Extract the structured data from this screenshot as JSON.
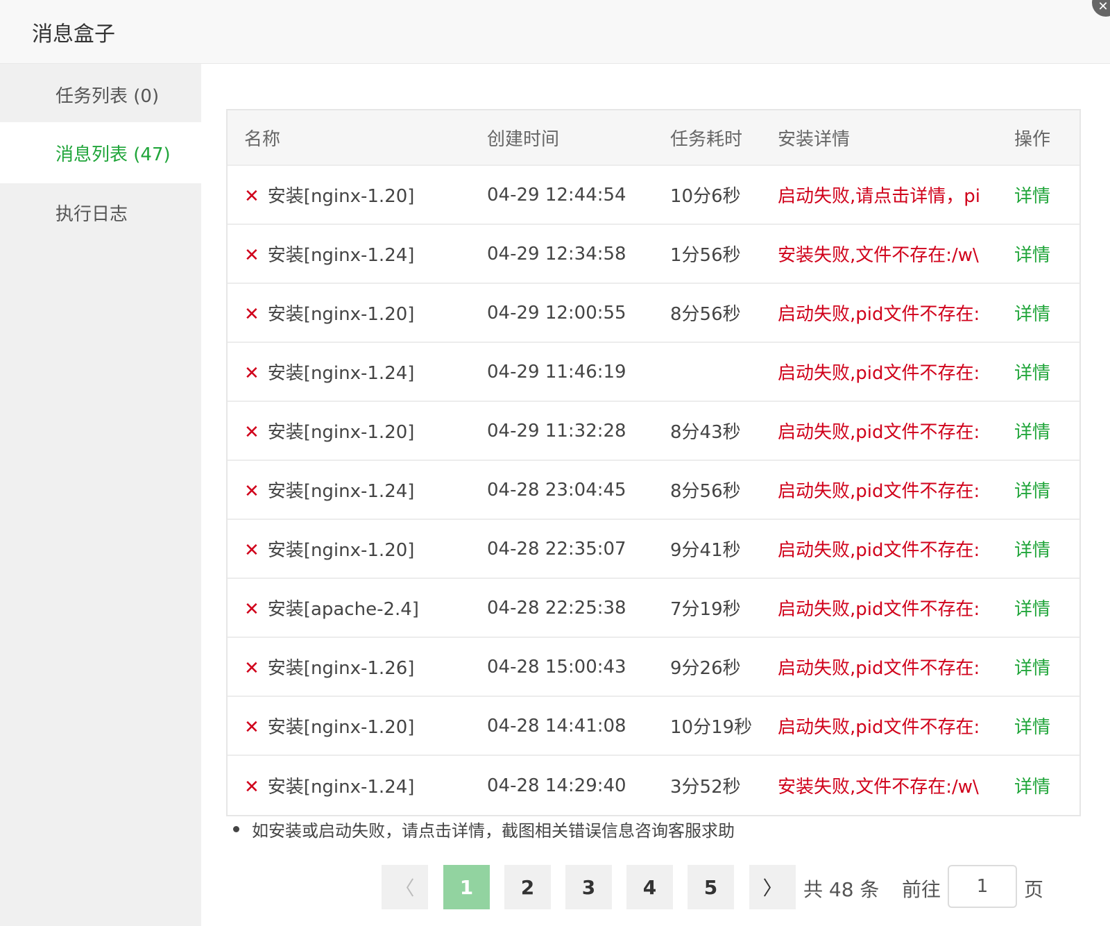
{
  "header": {
    "title": "消息盒子"
  },
  "sidebar": {
    "items": [
      {
        "label": "任务列表 (0)"
      },
      {
        "label": "消息列表 (47)"
      },
      {
        "label": "执行日志"
      }
    ]
  },
  "table": {
    "columns": [
      "名称",
      "创建时间",
      "任务耗时",
      "安装详情",
      "操作"
    ],
    "rows": [
      {
        "name": "安装[nginx-1.20]",
        "time": "04-29 12:44:54",
        "duration": "10分6秒",
        "detail": "启动失败,请点击详情，pi",
        "action": "详情"
      },
      {
        "name": "安装[nginx-1.24]",
        "time": "04-29 12:34:58",
        "duration": "1分56秒",
        "detail": "安装失败,文件不存在:/w\\",
        "action": "详情"
      },
      {
        "name": "安装[nginx-1.20]",
        "time": "04-29 12:00:55",
        "duration": "8分56秒",
        "detail": "启动失败,pid文件不存在:",
        "action": "详情"
      },
      {
        "name": "安装[nginx-1.24]",
        "time": "04-29 11:46:19",
        "duration": "",
        "detail": "启动失败,pid文件不存在:",
        "action": "详情"
      },
      {
        "name": "安装[nginx-1.20]",
        "time": "04-29 11:32:28",
        "duration": "8分43秒",
        "detail": "启动失败,pid文件不存在:",
        "action": "详情"
      },
      {
        "name": "安装[nginx-1.24]",
        "time": "04-28 23:04:45",
        "duration": "8分56秒",
        "detail": "启动失败,pid文件不存在:",
        "action": "详情"
      },
      {
        "name": "安装[nginx-1.20]",
        "time": "04-28 22:35:07",
        "duration": "9分41秒",
        "detail": "启动失败,pid文件不存在:",
        "action": "详情"
      },
      {
        "name": "安装[apache-2.4]",
        "time": "04-28 22:25:38",
        "duration": "7分19秒",
        "detail": "启动失败,pid文件不存在:",
        "action": "详情"
      },
      {
        "name": "安装[nginx-1.26]",
        "time": "04-28 15:00:43",
        "duration": "9分26秒",
        "detail": "启动失败,pid文件不存在:",
        "action": "详情"
      },
      {
        "name": "安装[nginx-1.20]",
        "time": "04-28 14:41:08",
        "duration": "10分19秒",
        "detail": "启动失败,pid文件不存在:",
        "action": "详情"
      },
      {
        "name": "安装[nginx-1.24]",
        "time": "04-28 14:29:40",
        "duration": "3分52秒",
        "detail": "安装失败,文件不存在:/w\\",
        "action": "详情"
      }
    ]
  },
  "note": "如安装或启动失败，请点击详情，截图相关错误信息咨询客服求助",
  "pagination": {
    "pages": [
      "1",
      "2",
      "3",
      "4",
      "5"
    ],
    "active_page": "1",
    "total": "共 48 条",
    "goto_label": "前往",
    "goto_value": "1",
    "page_unit": "页"
  },
  "colors": {
    "accent": "#20a53a",
    "error": "#d0021b",
    "active_page_bg": "#92d3a0"
  },
  "icons": {
    "row_status": "close-x-icon",
    "prev": "chevron-left-icon",
    "next": "chevron-right-icon"
  }
}
